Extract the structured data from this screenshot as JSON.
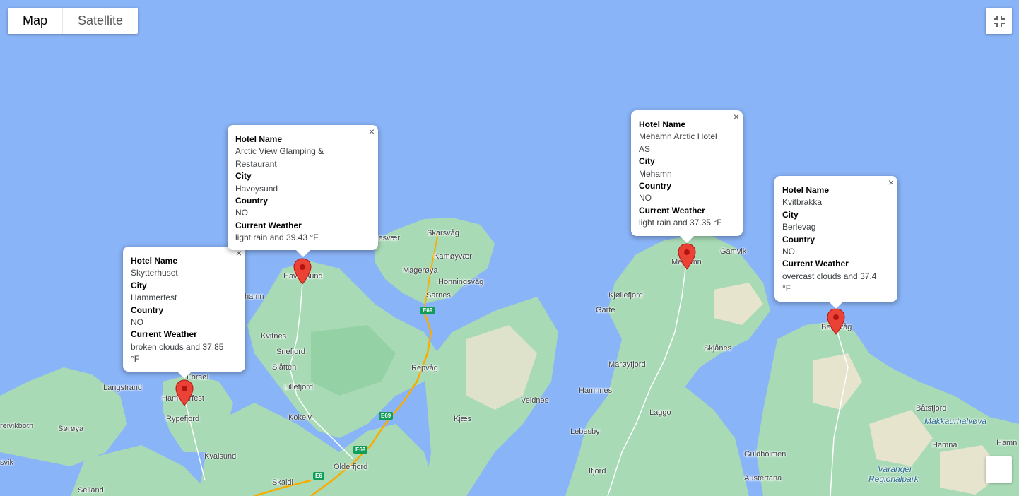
{
  "map_type": {
    "map_label": "Map",
    "satellite_label": "Satellite",
    "selected": "Map"
  },
  "colors": {
    "water": "#8ab4f8",
    "land": "#a8dab5",
    "land_dark": "#94d2a5",
    "sand": "#f5e6d3",
    "road": "#f9ab00",
    "marker": "#ea4335"
  },
  "places": {
    "bjesvaer": "jesvær",
    "skarsvag": "Skarsvåg",
    "kamoyvaer": "Kamøyvær",
    "mageroya": "Magerøya",
    "honningsvag": "Honningsvåg",
    "sarnes": "Sarnes",
    "havoysund": "Havøysund",
    "hamn": "hamn",
    "kvitnes": "Kvitnes",
    "snefjord": "Snefjord",
    "slatten": "Slåtten",
    "lillefjord": "Lillefjord",
    "repvag": "Repvåg",
    "forsol": "Forsøl",
    "langstrand": "Langstrand",
    "hammerfest": "Hammerfest",
    "rypefjord": "Rypefjord",
    "reivikbotn": "reivikbotn",
    "soroya": "Sørøya",
    "kokelv": "Kokelv",
    "kjaes": "Kjæs",
    "veidnes": "Veidnes",
    "kvalsund": "Kvalsund",
    "olderfjord": "Olderfjord",
    "skaidi": "Skaidi",
    "seiland": "Seiland",
    "svik": "svik",
    "mehamn": "Mehamn",
    "gamvik": "Gamvik",
    "kjollefjord": "Kjøllefjord",
    "garte": "Garte",
    "skjanes": "Skjånes",
    "maroyfjord": "Marøyfjord",
    "hamnnes": "Hamnnes",
    "laggo": "Laggo",
    "lebesby": "Lebesby",
    "ifjord": "Ifjord",
    "guldholmen": "Guldholmen",
    "austertana": "Austertana",
    "berlevag": "Berlevåg",
    "batsfjord": "Båtsfjord",
    "makkaurhalvoya": "Makkaurhalvøya",
    "hamna": "Hamna",
    "hamn_right": "Hamn",
    "varanger": "Varanger",
    "regionalpark": "Regionalpark"
  },
  "roads": {
    "e69": "E69",
    "e6": "E6"
  },
  "info_windows": [
    {
      "hotel_name_label": "Hotel Name",
      "hotel_name": "Skytterhuset",
      "city_label": "City",
      "city": "Hammerfest",
      "country_label": "Country",
      "country": "NO",
      "weather_label": "Current Weather",
      "weather": "broken clouds and 37.85 °F",
      "close": "×"
    },
    {
      "hotel_name_label": "Hotel Name",
      "hotel_name": "Arctic View Glamping & Restaurant",
      "city_label": "City",
      "city": "Havoysund",
      "country_label": "Country",
      "country": "NO",
      "weather_label": "Current Weather",
      "weather": "light rain and 39.43 °F",
      "close": "×"
    },
    {
      "hotel_name_label": "Hotel Name",
      "hotel_name": "Mehamn Arctic Hotel AS",
      "city_label": "City",
      "city": "Mehamn",
      "country_label": "Country",
      "country": "NO",
      "weather_label": "Current Weather",
      "weather": "light rain and 37.35 °F",
      "close": "×"
    },
    {
      "hotel_name_label": "Hotel Name",
      "hotel_name": "Kvitbrakka",
      "city_label": "City",
      "city": "Berlevag",
      "country_label": "Country",
      "country": "NO",
      "weather_label": "Current Weather",
      "weather": "overcast clouds and 37.4 °F",
      "close": "×"
    }
  ],
  "icons": {
    "fullscreen": "fullscreen-exit-icon",
    "marker": "map-marker-icon"
  }
}
